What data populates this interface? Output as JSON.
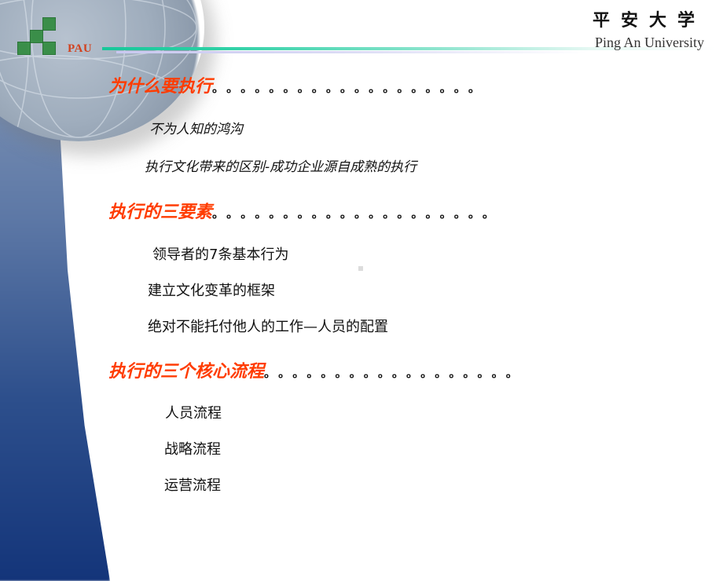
{
  "header": {
    "logo_text": "PAU",
    "university_cn": "平安大学",
    "university_en": "Ping An University",
    "accent_color": "#ff3c00",
    "rule_color": "#18c79a"
  },
  "sections": [
    {
      "heading": "为什么要执行",
      "dots": "。。。。。。。。。。。。。。。。。。。",
      "items": [
        "不为人知的鸿沟",
        "执行文化带来的区别-成功企业源自成熟的执行"
      ]
    },
    {
      "heading": "执行的三要素",
      "dots": "。。。。。。。。。。。。。。。。。。。。",
      "items": [
        "领导者的7条基本行为",
        "建立文化变革的框架",
        "绝对不能托付他人的工作—人员的配置"
      ]
    },
    {
      "heading": "执行的三个核心流程",
      "dots": "。。。。。。。。。。。。。。。。。。",
      "items": [
        "人员流程",
        "战略流程",
        "运营流程"
      ]
    }
  ]
}
